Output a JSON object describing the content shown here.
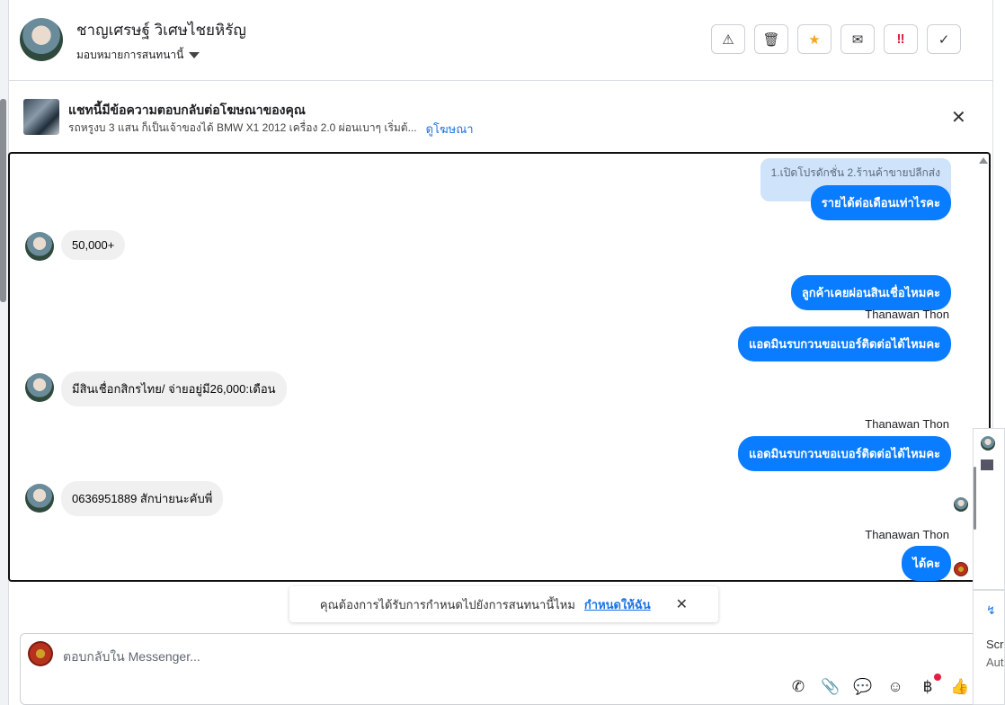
{
  "header": {
    "name": "ชาญเศรษฐ์ วิเศษไชยหิรัญ",
    "assign_label": "มอบหมายการสนทนานี้",
    "toolbar": [
      {
        "icon": "warning-icon",
        "glyph": "⚠"
      },
      {
        "icon": "trash-icon",
        "glyph": "🗑"
      },
      {
        "icon": "star-icon",
        "glyph": "★"
      },
      {
        "icon": "envelope-icon",
        "glyph": "✉"
      },
      {
        "icon": "urgent-icon",
        "glyph": "‼"
      },
      {
        "icon": "check-icon",
        "glyph": "✓"
      }
    ]
  },
  "ad": {
    "title": "แชทนี้มีข้อความตอบกลับต่อโฆษณาของคุณ",
    "subtitle": "รถหรูงบ 3 แสน ก็เป็นเจ้าของได้ BMW X1 2012 เครื่อง 2.0 ผ่อนเบาๆ เริ่มต้...",
    "link": "ดูโฆษณา"
  },
  "messages": {
    "quote": "1.เปิดโปรดักชั่น 2.ร้านค้าขายปลีกส่ง",
    "m1": "รายได้ต่อเดือนเท่าไรคะ",
    "m2": "50,000+",
    "m3": "ลูกค้าเคยผ่อนสินเชื่อไหมคะ",
    "sender1": "Thanawan Thon",
    "m4": "แอดมินรบกวนขอเบอร์ติดต่อได้ไหมคะ",
    "m5": "มีสินเชื่อกสิกรไทย/ จ่ายอยู่มี26,000:เดือน",
    "sender2": "Thanawan Thon",
    "m6": "แอดมินรบกวนขอเบอร์ติดต่อได้ไหมคะ",
    "m7": "0636951889  สักบ่ายนะคับพี่",
    "sender3": "Thanawan Thon",
    "m8": "ได้คะ"
  },
  "toast": {
    "text": "คุณต้องการได้รับการกำหนดไปยังการสนทนานี้ไหม",
    "link": "กำหนดให้ฉัน"
  },
  "composer": {
    "placeholder": "ตอบกลับใน Messenger..."
  },
  "side_panel": {
    "line1": "Scr",
    "line2": "Aut"
  },
  "colors": {
    "accent": "#0a7cff",
    "link": "#1b74e4",
    "bubble_in": "#f0f0f0",
    "quote_bg": "#cfe3fb"
  }
}
